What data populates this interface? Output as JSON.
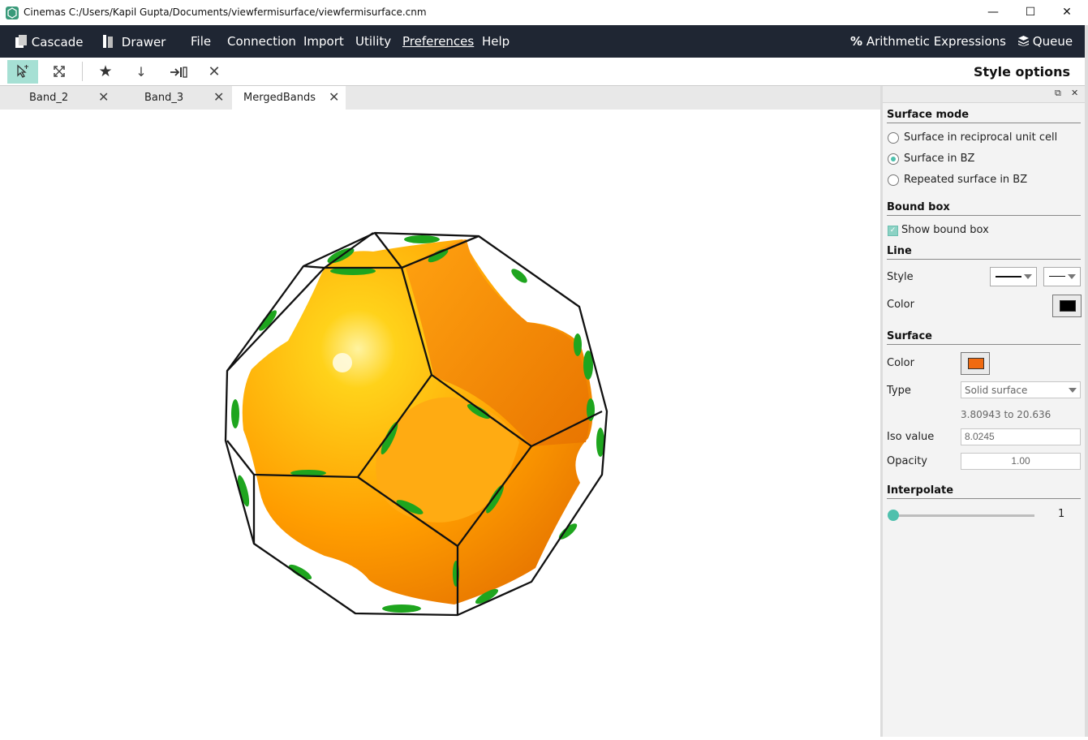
{
  "window": {
    "title": "Cinemas C:/Users/Kapil Gupta/Documents/viewfermisurface/viewfermisurface.cnm",
    "controls": {
      "minimize": "—",
      "maximize": "☐",
      "close": "✕"
    }
  },
  "menubar": {
    "cascade": "Cascade",
    "drawer": "Drawer",
    "items": [
      "File",
      "Connection",
      "Import",
      "Utility",
      "Preferences",
      "Help"
    ],
    "arithmetic": "Arithmetic Expressions",
    "queue": "Queue"
  },
  "toolbar": {
    "icons": [
      "select-cursor-icon",
      "fit-view-icon",
      "star-icon",
      "arrow-down-icon",
      "export-icon",
      "close-icon"
    ],
    "style_options": "Style options"
  },
  "tabs": [
    {
      "label": "Band_2",
      "active": false
    },
    {
      "label": "Band_3",
      "active": false
    },
    {
      "label": "MergedBands",
      "active": true
    }
  ],
  "viewport": {
    "surface_color": "#ff8c00",
    "secondary_color": "#1ea51e",
    "edge_color": "#111111"
  },
  "panel": {
    "surface_mode": {
      "title": "Surface mode",
      "options": [
        {
          "label": "Surface in reciprocal unit cell",
          "selected": false
        },
        {
          "label": "Surface in BZ",
          "selected": true
        },
        {
          "label": "Repeated surface in BZ",
          "selected": false
        }
      ]
    },
    "bound_box": {
      "title": "Bound box",
      "show_label": "Show bound box",
      "checked": true
    },
    "line": {
      "title": "Line",
      "style_label": "Style",
      "color_label": "Color",
      "color": "#000000"
    },
    "surface": {
      "title": "Surface",
      "color_label": "Color",
      "color": "#f06a10",
      "type_label": "Type",
      "type_value": "Solid surface",
      "range": "3.80943 to 20.636",
      "iso_label": "Iso value",
      "iso_value": "8.0245",
      "opacity_label": "Opacity",
      "opacity_value": "1.00"
    },
    "interpolate": {
      "title": "Interpolate",
      "value": "1",
      "level": 0
    }
  }
}
